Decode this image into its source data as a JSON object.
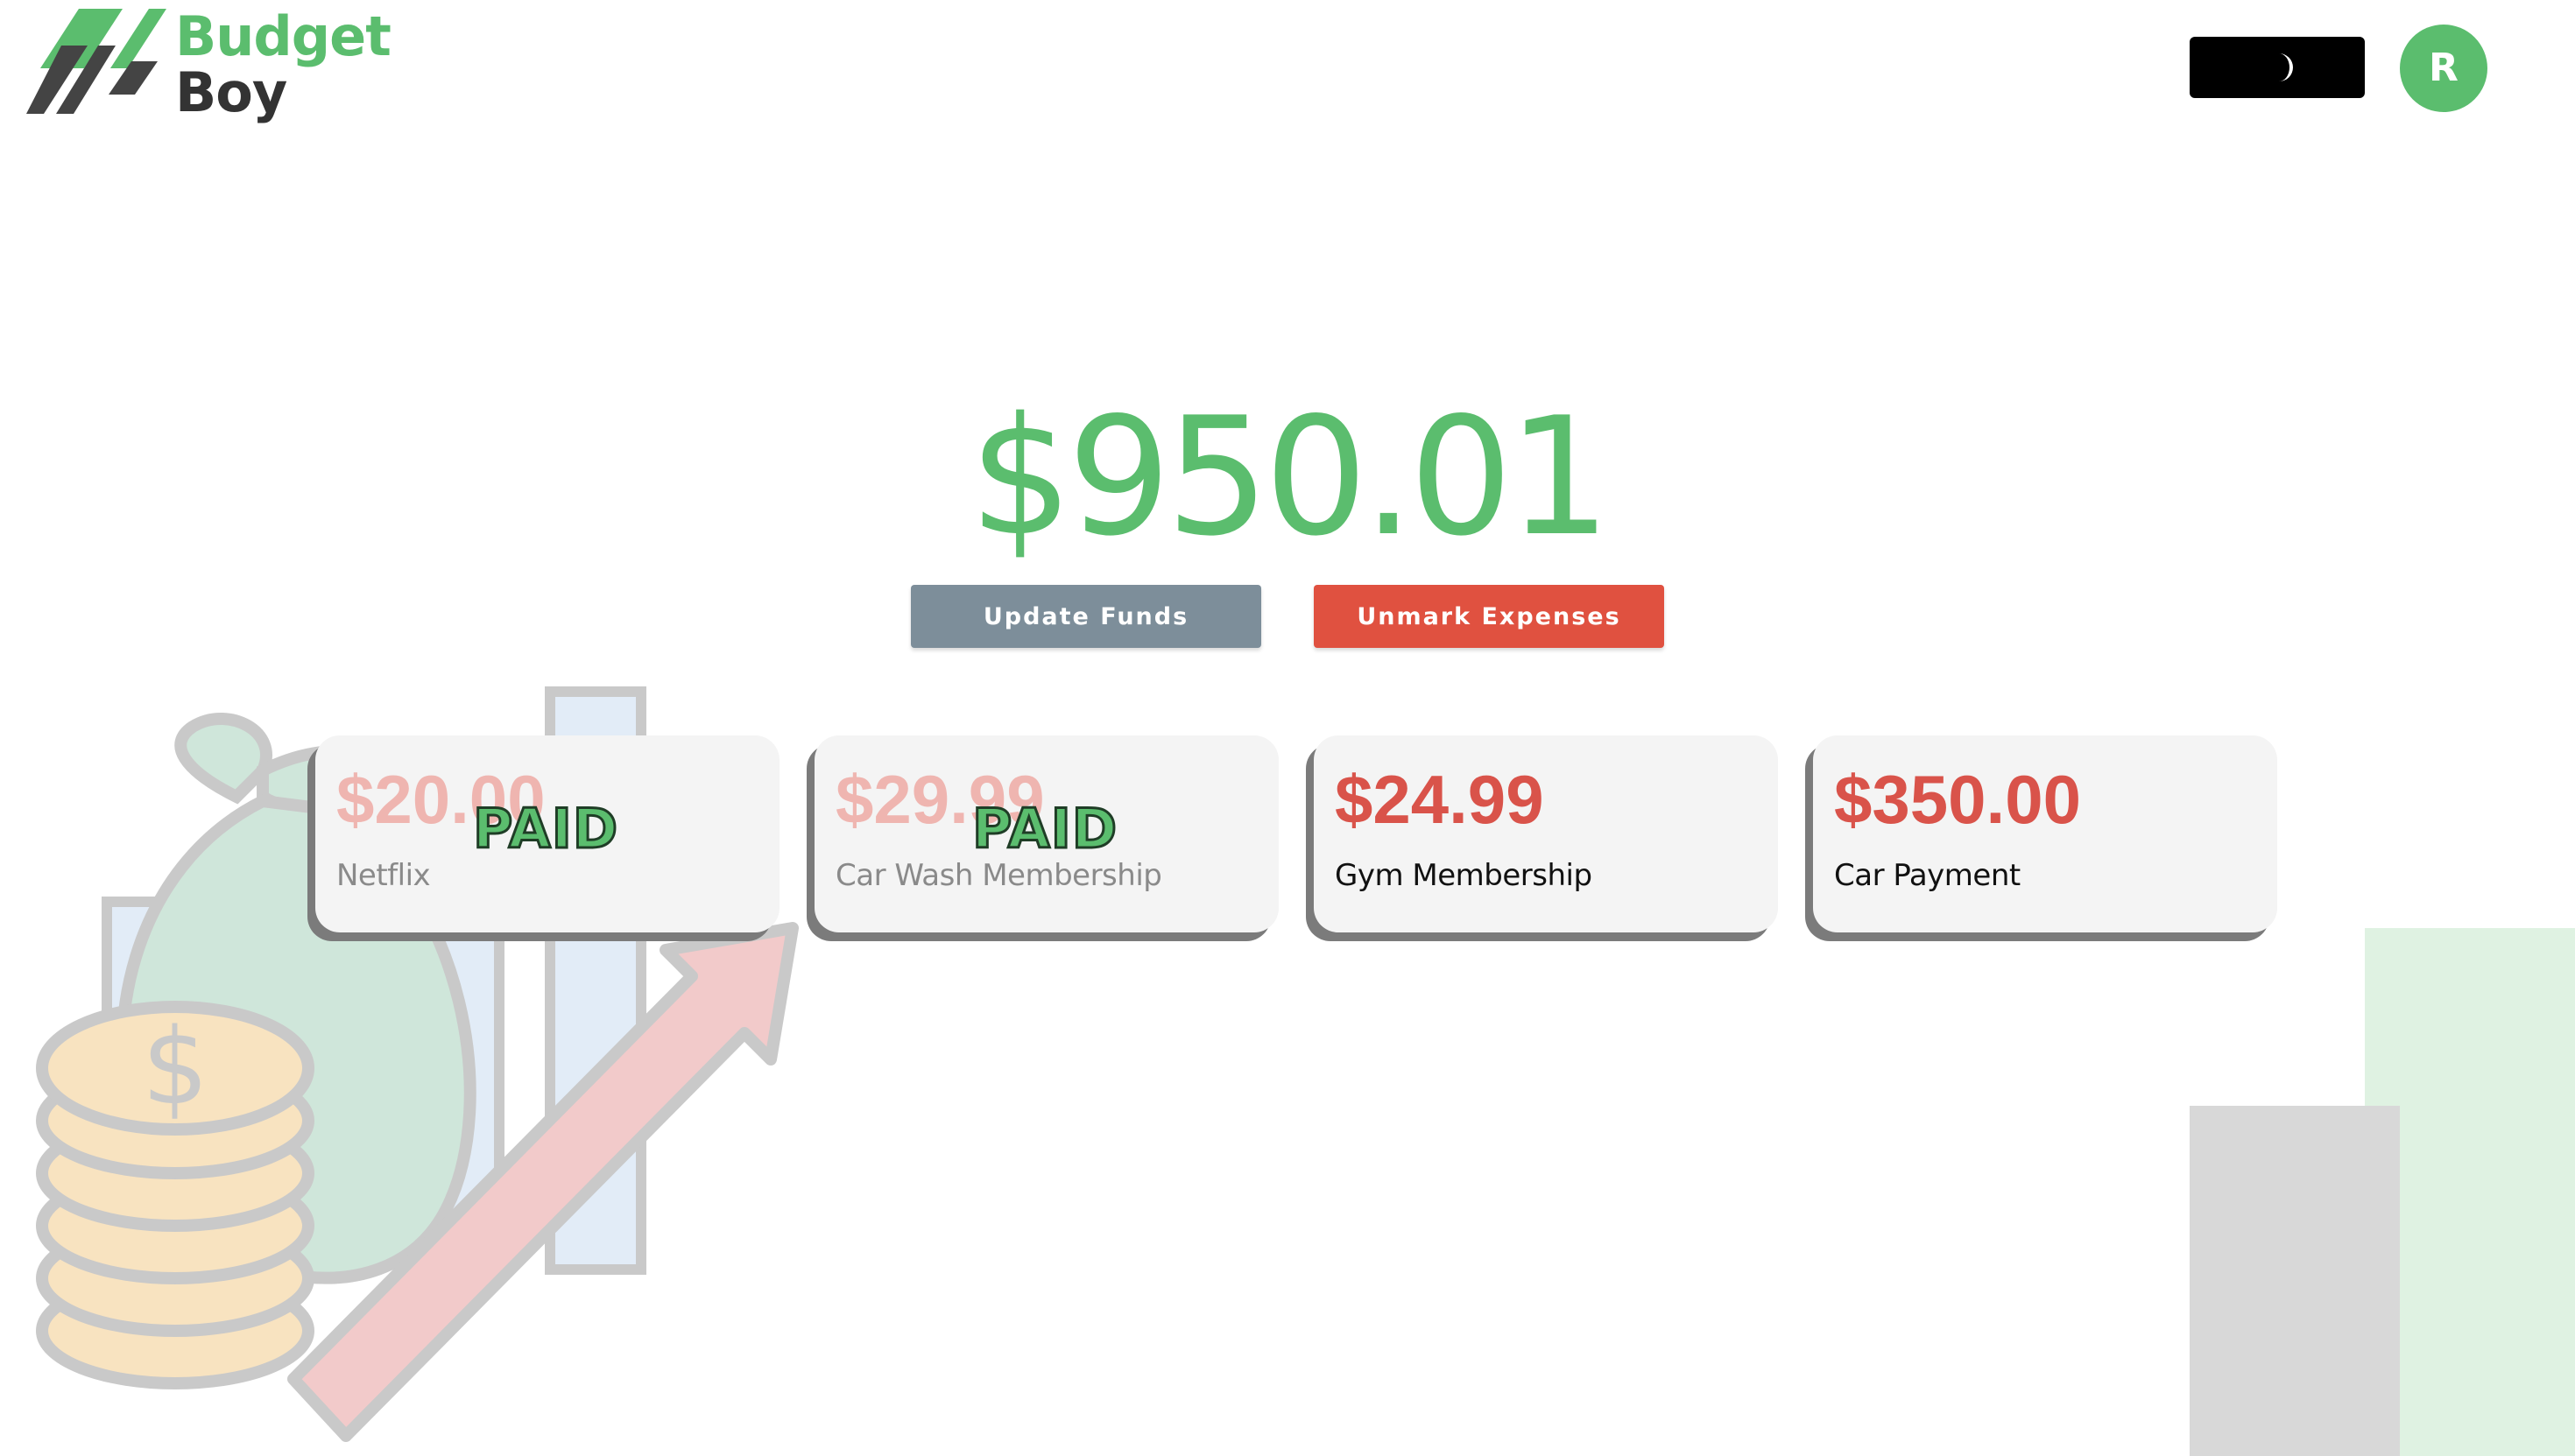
{
  "brand": {
    "line1": "Budget",
    "line2": "Boy",
    "logo_icon": "stripes-logo-icon",
    "green": "#5bbd6e",
    "dark": "#333333"
  },
  "header": {
    "theme_toggle_icon": "moon-icon",
    "avatar_initial": "R"
  },
  "balance": {
    "amount": "$950.01",
    "color": "#5bbd6e"
  },
  "actions": {
    "update_funds": "Update Funds",
    "unmark_expenses": "Unmark Expenses",
    "update_color": "#7d8e9a",
    "unmark_color": "#e05140"
  },
  "expenses": [
    {
      "amount": "$20.00",
      "name": "Netflix",
      "paid": true,
      "paid_label": "PAID"
    },
    {
      "amount": "$29.99",
      "name": "Car Wash Membership",
      "paid": true,
      "paid_label": "PAID"
    },
    {
      "amount": "$24.99",
      "name": "Gym Membership",
      "paid": false
    },
    {
      "amount": "$350.00",
      "name": "Car Payment",
      "paid": false
    }
  ],
  "illustration": {
    "icons": [
      "money-bag-icon",
      "coin-stack-icon",
      "bar-chart-icon",
      "growth-arrow-icon"
    ]
  }
}
